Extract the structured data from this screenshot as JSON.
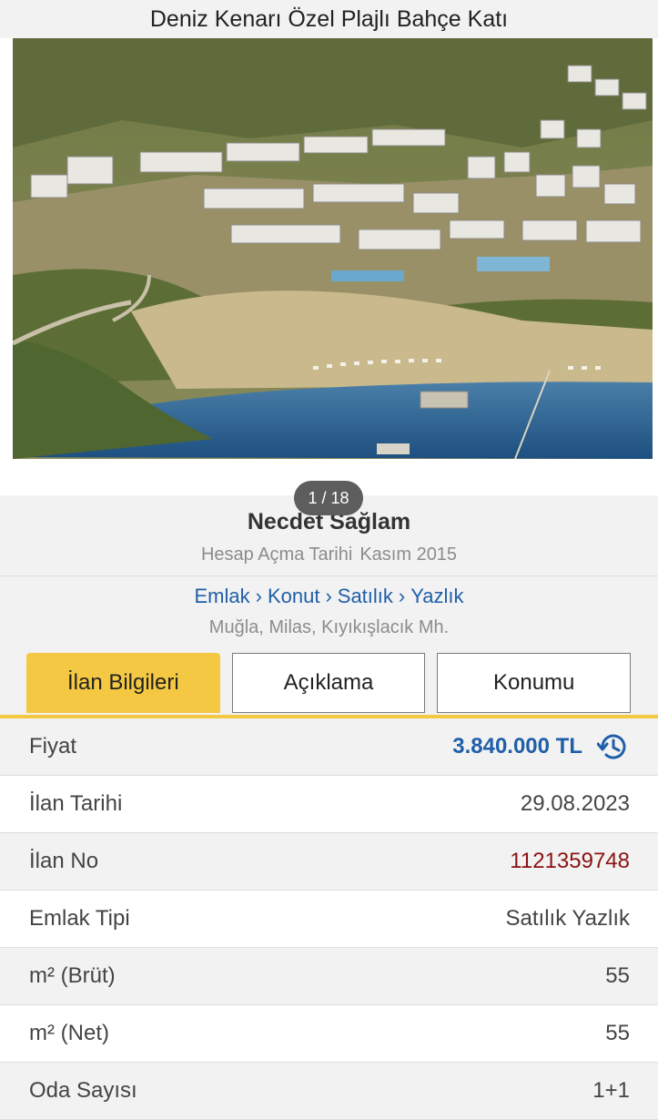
{
  "header": {
    "title": "Deniz Kenarı Özel Plajlı Bahçe Katı"
  },
  "gallery": {
    "counter": "1 / 18"
  },
  "seller": {
    "name": "Necdet Sağlam",
    "since_label": "Hesap Açma Tarihi",
    "since_value": "Kasım 2015"
  },
  "breadcrumb": {
    "items": [
      "Emlak",
      "Konut",
      "Satılık",
      "Yazlık"
    ],
    "separator": "›"
  },
  "location": "Muğla, Milas, Kıyıkışlacık Mh.",
  "tabs": [
    {
      "label": "İlan Bilgileri",
      "active": true
    },
    {
      "label": "Açıklama",
      "active": false
    },
    {
      "label": "Konumu",
      "active": false
    }
  ],
  "details": [
    {
      "label": "Fiyat",
      "value": "3.840.000 TL"
    },
    {
      "label": "İlan Tarihi",
      "value": "29.08.2023"
    },
    {
      "label": "İlan No",
      "value": "1121359748"
    },
    {
      "label": "Emlak Tipi",
      "value": "Satılık Yazlık"
    },
    {
      "label": "m² (Brüt)",
      "value": "55"
    },
    {
      "label": "m² (Net)",
      "value": "55"
    },
    {
      "label": "Oda Sayısı",
      "value": "1+1"
    }
  ],
  "colors": {
    "accent": "#f4c842",
    "link": "#1f5fa8",
    "price": "#1f5fa8",
    "listing_no": "#8a1212"
  }
}
